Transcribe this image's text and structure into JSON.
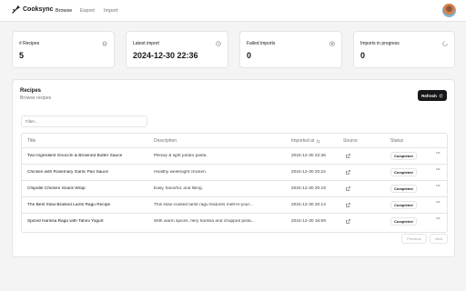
{
  "nav": {
    "brand": "Cooksync",
    "links": [
      "Browse",
      "Export",
      "Import"
    ]
  },
  "stats": [
    {
      "title": "# Recipes",
      "value": "5",
      "icon": "chef-hat-icon"
    },
    {
      "title": "Latest import",
      "value": "2024-12-30 22:36",
      "icon": "clock-icon"
    },
    {
      "title": "Failed imports",
      "value": "0",
      "icon": "x-circle-icon"
    },
    {
      "title": "Imports in progress",
      "value": "0",
      "icon": "loader-circle-icon"
    }
  ],
  "recipes": {
    "title": "Recipes",
    "subtitle": "Browse recipes",
    "refresh_label": "Refresh",
    "filter_placeholder": "Filter...",
    "columns": [
      "Title",
      "Description",
      "Imported at",
      "Source",
      "Status"
    ],
    "rows": [
      {
        "title": "Two Ingredient Gnocchi & Browned Butter Sauce",
        "description": "Pillowy & light potato pasta.",
        "imported_at": "2024-12-30 22:36",
        "status": "Completed"
      },
      {
        "title": "Chicken with Rosemary Garlic Pan Sauce",
        "description": "Healthy weeknight chicken.",
        "imported_at": "2024-12-30 20:22",
        "status": "Completed"
      },
      {
        "title": "Chipotle Chicken Snack Wrap",
        "description": "Easy, flavorful, and filling.",
        "imported_at": "2024-12-30 20:19",
        "status": "Completed"
      },
      {
        "title": "The Best Slow-Braised Lamb Ragu Recipe",
        "description": "This slow-cooked lamb ragu features melt-in-your...",
        "imported_at": "2024-12-30 20:14",
        "status": "Completed"
      },
      {
        "title": "Spiced Harissa Ragù with Tahini Yogurt",
        "description": "With warm spices, fiery harissa and chopped pista...",
        "imported_at": "2024-12-30 16:59",
        "status": "Completed"
      }
    ],
    "previous_label": "Previous",
    "next_label": "Next"
  },
  "colors": {
    "accent": "#18181b",
    "muted": "#71717a",
    "border": "#e4e4e7"
  }
}
